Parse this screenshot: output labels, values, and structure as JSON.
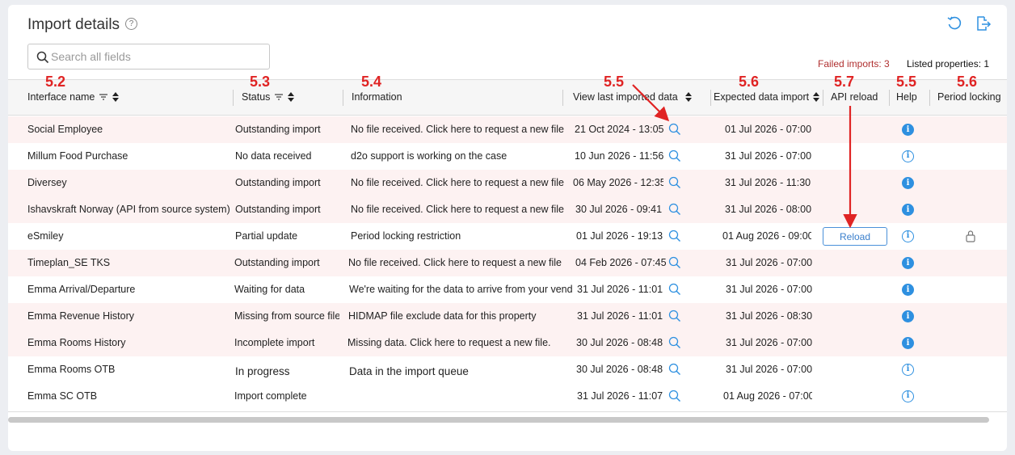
{
  "page": {
    "title": "Import details",
    "search_placeholder": "Search all fields",
    "failed_imports": "Failed imports: 3",
    "listed_properties": "Listed properties: 1"
  },
  "columns": {
    "interface": "Interface name",
    "status": "Status",
    "information": "Information",
    "view_last": "View last imported data",
    "expected": "Expected data import",
    "api_reload": "API reload",
    "help": "Help",
    "period_locking": "Period locking"
  },
  "annotations": {
    "a1": "5.2",
    "a2": "5.3",
    "a3": "5.4",
    "a4": "5.5",
    "a5": "5.6",
    "a6": "5.7",
    "a7": "5.5",
    "a8": "5.6"
  },
  "reload_label": "Reload",
  "rows": [
    {
      "name": "Social Employee",
      "status": "Outstanding import",
      "info": "No file received. Click here to request a new file",
      "last": "21 Oct 2024 - 13:05",
      "expected": "01 Jul 2026 - 07:00",
      "help_icon": "info-solid"
    },
    {
      "name": "Millum Food Purchase",
      "status": "No data received",
      "info": "d2o support is working on the case",
      "last": "10 Jun 2026 - 11:56",
      "expected": "31 Jul 2026 - 07:00",
      "help_icon": "info-outline"
    },
    {
      "name": "Diversey",
      "status": "Outstanding import",
      "info": "No file received. Click here to request a new file",
      "last": "06 May 2026 - 12:35",
      "expected": "31 Jul 2026 - 11:30",
      "help_icon": "info-solid"
    },
    {
      "name": "Ishavskraft Norway (API from source system)",
      "status": "Outstanding import",
      "info": "No file received. Click here to request a new file",
      "last": "30 Jul 2026 - 09:41",
      "expected": "31 Jul 2026 - 08:00",
      "help_icon": "info-solid"
    },
    {
      "name": "eSmiley",
      "status": "Partial update",
      "info": "Period locking restriction",
      "last": "01 Jul 2026 - 19:13",
      "expected": "01 Aug 2026 - 09:00",
      "help_icon": "info-outline"
    },
    {
      "name": "Timeplan_SE TKS",
      "status": "Outstanding import",
      "info": "No file received. Click here to request a new file",
      "last": "04 Feb 2026 - 07:45",
      "expected": "31 Jul 2026 - 07:00",
      "help_icon": "info-solid"
    },
    {
      "name": "Emma Arrival/Departure",
      "status": "Waiting for data",
      "info": "We're waiting for the data to arrive from your vend",
      "last": "31 Jul 2026 - 11:01",
      "expected": "31 Jul 2026 - 07:00",
      "help_icon": "info-solid"
    },
    {
      "name": "Emma Revenue History",
      "status": "Missing from source file",
      "info": "HIDMAP file exclude data for this property",
      "last": "31 Jul 2026 - 11:01",
      "expected": "31 Jul 2026 - 08:30",
      "help_icon": "info-solid"
    },
    {
      "name": "Emma Rooms History",
      "status": "Incomplete import",
      "info": "Missing data. Click here to request a new file.",
      "last": "30 Jul 2026 - 08:48",
      "expected": "31 Jul 2026 - 07:00",
      "help_icon": "info-solid"
    },
    {
      "name": "Emma Rooms OTB",
      "status": "In progress",
      "info": "Data in the import queue",
      "last": "30 Jul 2026 - 08:48",
      "expected": "31 Jul 2026 - 07:00",
      "help_icon": "info-outline"
    },
    {
      "name": "Emma SC OTB",
      "status": "Import complete",
      "info": "",
      "last": "31 Jul 2026 - 11:07",
      "expected": "01 Aug 2026 - 07:00",
      "help_icon": "info-outline"
    }
  ]
}
